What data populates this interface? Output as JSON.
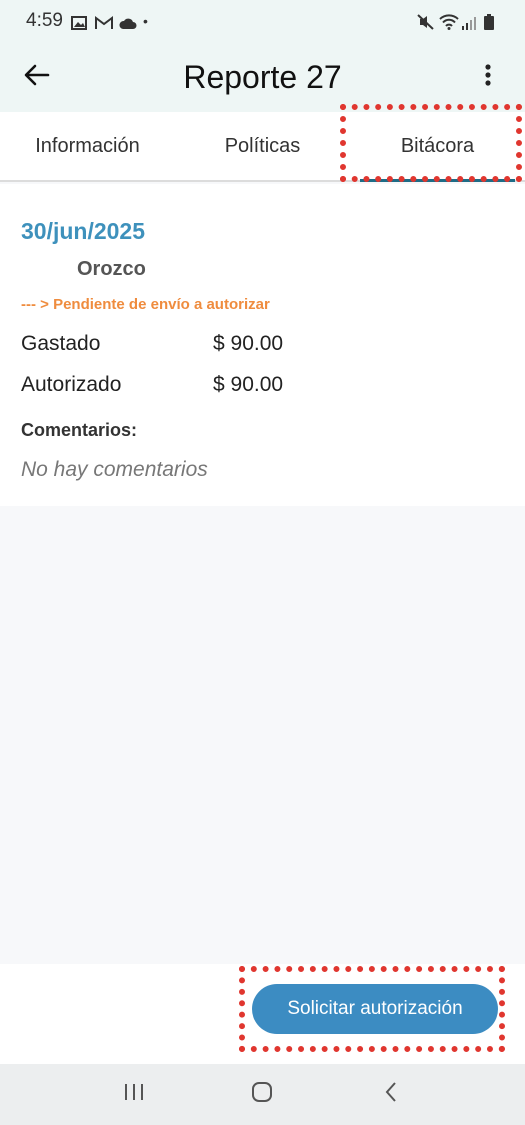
{
  "status_bar": {
    "time": "4:59",
    "icons": [
      "image-icon",
      "gmail-icon",
      "cloud-icon",
      "dot-icon",
      "mute-icon",
      "wifi-icon",
      "signal-icon",
      "battery-icon"
    ]
  },
  "app_bar": {
    "title": "Reporte 27",
    "back_icon": "arrow-left-icon",
    "more_icon": "more-vertical-icon"
  },
  "tabs": [
    {
      "label": "Información",
      "active": false
    },
    {
      "label": "Políticas",
      "active": false
    },
    {
      "label": "Bitácora",
      "active": true
    }
  ],
  "log_entry": {
    "date": "30/jun/2025",
    "user": "Orozco",
    "status": "--- > Pendiente de envío a autorizar",
    "spent_label": "Gastado",
    "spent_value": "$ 90.00",
    "authorized_label": "Autorizado",
    "authorized_value": "$ 90.00",
    "comments_label": "Comentarios:",
    "comments_empty": "No hay comentarios"
  },
  "actions": {
    "request_button": "Solicitar autorización"
  },
  "colors": {
    "accent": "#3c8cc2",
    "date": "#3e91bc",
    "status": "#ef8c3e",
    "highlight": "#e0362f"
  }
}
